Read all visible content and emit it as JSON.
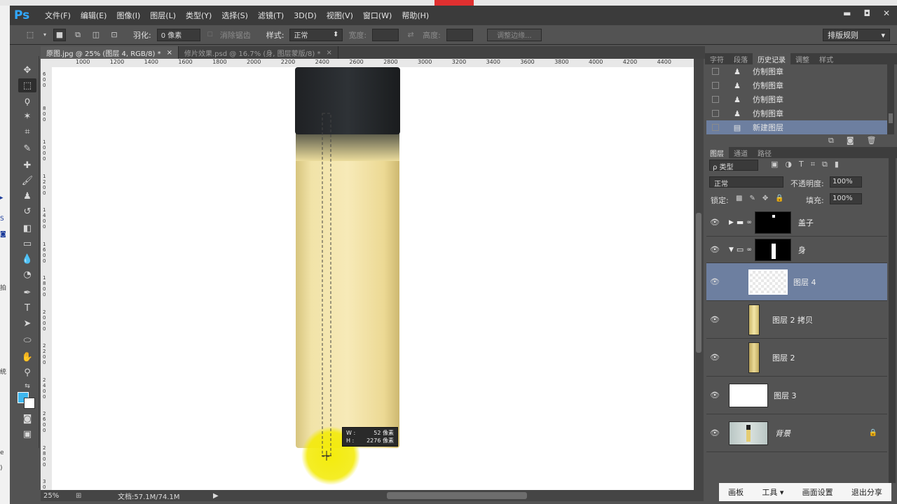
{
  "app": {
    "logo": "Ps"
  },
  "menu": [
    "文件(F)",
    "编辑(E)",
    "图像(I)",
    "图层(L)",
    "类型(Y)",
    "选择(S)",
    "滤镜(T)",
    "3D(D)",
    "视图(V)",
    "窗口(W)",
    "帮助(H)"
  ],
  "window_buttons": {
    "minimize": "▬",
    "restore": "◘",
    "close": "✕"
  },
  "options": {
    "feather_label": "羽化:",
    "feather_value": "0 像素",
    "antialias_label": "消除锯齿",
    "style_label": "样式:",
    "style_value": "正常",
    "width_label": "宽度:",
    "height_label": "高度:",
    "refine_edge": "调整边缘...",
    "workspace": "排版规则"
  },
  "tabs": [
    {
      "label": "原图.jpg @ 25% (图层 4, RGB/8) *",
      "close": "×"
    },
    {
      "label": "修片效果.psd @ 16.7% (身, 图层蒙版/8) *",
      "close": "×"
    }
  ],
  "ruler_h": [
    "1000",
    "1200",
    "1400",
    "1600",
    "1800",
    "2000",
    "2200",
    "2400",
    "2600",
    "2800",
    "3000",
    "3200",
    "3400",
    "3600",
    "3800",
    "4000",
    "4200",
    "4400"
  ],
  "ruler_v": [
    "600",
    "800",
    "1000",
    "1200",
    "1400",
    "1600",
    "1800",
    "2000",
    "2200",
    "2400",
    "2600",
    "2800",
    "3000"
  ],
  "left_edge_marks": [
    "▸",
    "S",
    "◙",
    "拍",
    "统",
    "e",
    ")"
  ],
  "tooltip": {
    "w_label": "W :",
    "w_value": "52 像素",
    "h_label": "H :",
    "h_value": "2276 像素"
  },
  "status": {
    "zoom": "25%",
    "doc": "文档:57.1M/74.1M",
    "arrow": "▶"
  },
  "history_tabs": [
    "字符",
    "段落",
    "历史记录",
    "调整",
    "样式"
  ],
  "history_items": [
    {
      "label": "仿制图章",
      "icon": "stamp-icon"
    },
    {
      "label": "仿制图章",
      "icon": "stamp-icon"
    },
    {
      "label": "仿制图章",
      "icon": "stamp-icon"
    },
    {
      "label": "仿制图章",
      "icon": "stamp-icon"
    },
    {
      "label": "新建图层",
      "icon": "new-layer-icon"
    }
  ],
  "layer_tabs": [
    "图层",
    "通道",
    "路径"
  ],
  "layers_controls": {
    "filter": "ρ 类型",
    "blend": "正常",
    "opacity_label": "不透明度:",
    "opacity": "100%",
    "lock_label": "锁定:",
    "fill_label": "填充:",
    "fill": "100%"
  },
  "layers": [
    {
      "name": "盖子"
    },
    {
      "name": "身"
    },
    {
      "name": "图层 4"
    },
    {
      "name": "图层 2 拷贝"
    },
    {
      "name": "图层 2"
    },
    {
      "name": "图层 3"
    },
    {
      "name": "背景"
    }
  ],
  "bottom_bar": [
    "画板",
    "工具 ▾",
    "画面设置",
    "退出分享"
  ],
  "colors": {
    "foreground": "#3fb7ef",
    "background": "#ffffff",
    "selected_row": "#6d7fa0",
    "highlight": "#f2ea00"
  }
}
